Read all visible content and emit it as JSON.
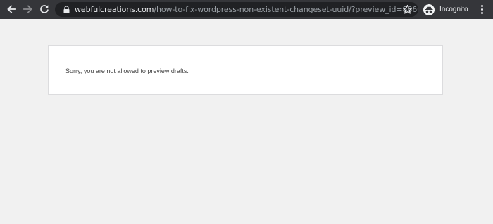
{
  "browser": {
    "url_host": "webfulcreations.com",
    "url_path": "/how-to-fix-wordpress-non-existent-changeset-uuid/?preview_id=886034&pre...",
    "profile_label": "Incognito",
    "icons": {
      "back": "back-arrow-icon",
      "forward": "forward-arrow-icon",
      "reload": "reload-icon",
      "lock": "lock-icon",
      "bookmark": "star-icon",
      "incognito": "incognito-icon",
      "menu": "kebab-menu-icon"
    },
    "colors": {
      "toolbar": "#35363a",
      "omnibox": "#202124"
    }
  },
  "page": {
    "message": "Sorry, you are not allowed to preview drafts."
  }
}
